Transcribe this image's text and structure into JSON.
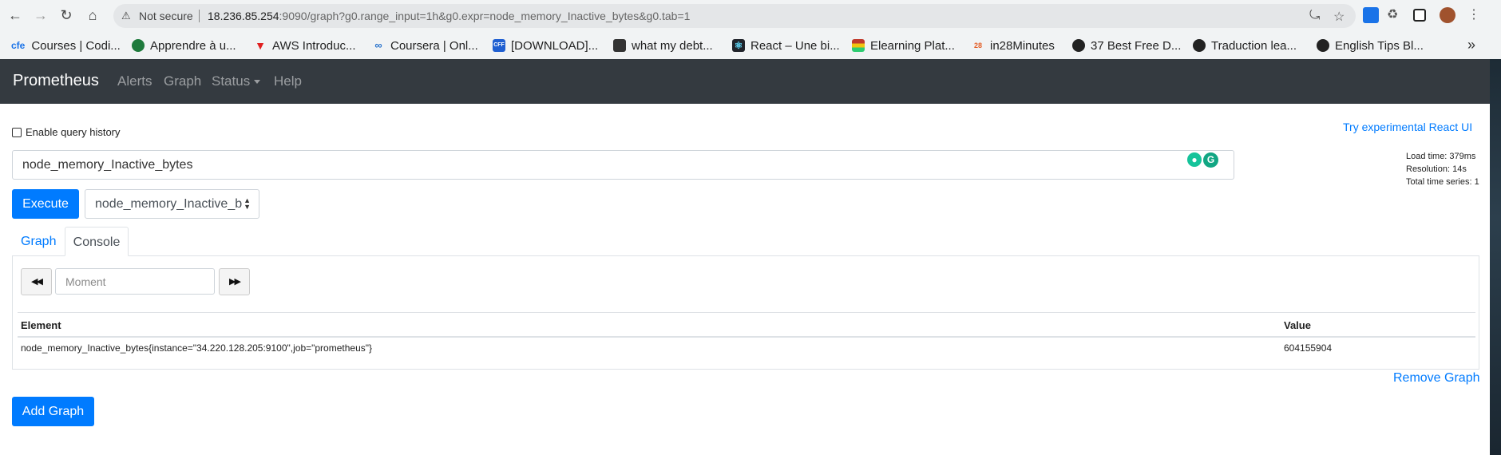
{
  "browser": {
    "security_label": "Not secure",
    "url_host": "18.236.85.254",
    "url_rest": ":9090/graph?g0.range_input=1h&g0.expr=node_memory_Inactive_bytes&g0.tab=1",
    "bookmarks": [
      {
        "label": "Courses | Codi...",
        "icon": "cfe",
        "color": "#1a73e8"
      },
      {
        "label": "Apprendre à u...",
        "icon": "globe-green-icon",
        "color": "#1e7a3c"
      },
      {
        "label": "AWS Introduc...",
        "icon": "red-v-icon",
        "color": "#e02020"
      },
      {
        "label": "Coursera | Onl...",
        "icon": "coursera-icon",
        "color": "#2a73cc"
      },
      {
        "label": "[DOWNLOAD]...",
        "icon": "cff-icon",
        "color": "#1f5fd1"
      },
      {
        "label": "what my debt...",
        "icon": "chart-icon",
        "color": "#333333"
      },
      {
        "label": "React – Une bi...",
        "icon": "react-icon",
        "color": "#20232a"
      },
      {
        "label": "Elearning Plat...",
        "icon": "bars-icon",
        "color": "#c0392b"
      },
      {
        "label": "in28Minutes",
        "icon": "in28-icon",
        "color": "#e35d26"
      },
      {
        "label": "37 Best Free D...",
        "icon": "globe-icon",
        "color": "#222222"
      },
      {
        "label": "Traduction lea...",
        "icon": "globe-icon",
        "color": "#222222"
      },
      {
        "label": "English Tips Bl...",
        "icon": "globe-icon",
        "color": "#222222"
      }
    ],
    "bookmarks_more": "»"
  },
  "navbar": {
    "brand": "Prometheus",
    "links": [
      "Alerts",
      "Graph",
      "Status",
      "Help"
    ]
  },
  "query": {
    "history_label": "Enable query history",
    "react_link": "Try experimental React UI",
    "expression": "node_memory_Inactive_bytes",
    "execute_label": "Execute",
    "metric_select": "node_memory_Inactive_bytes",
    "stats": {
      "load_time": "Load time: 379ms",
      "resolution": "Resolution: 14s",
      "total_series": "Total time series: 1"
    }
  },
  "tabs": {
    "graph": "Graph",
    "console": "Console"
  },
  "console": {
    "moment_placeholder": "Moment",
    "columns": [
      "Element",
      "Value"
    ],
    "rows": [
      {
        "element": "node_memory_Inactive_bytes{instance=\"34.220.128.205:9100\",job=\"prometheus\"}",
        "value": "604155904"
      }
    ]
  },
  "actions": {
    "remove_graph": "Remove Graph",
    "add_graph": "Add Graph"
  },
  "colors": {
    "primary": "#007bff",
    "navbar": "#343a40"
  }
}
